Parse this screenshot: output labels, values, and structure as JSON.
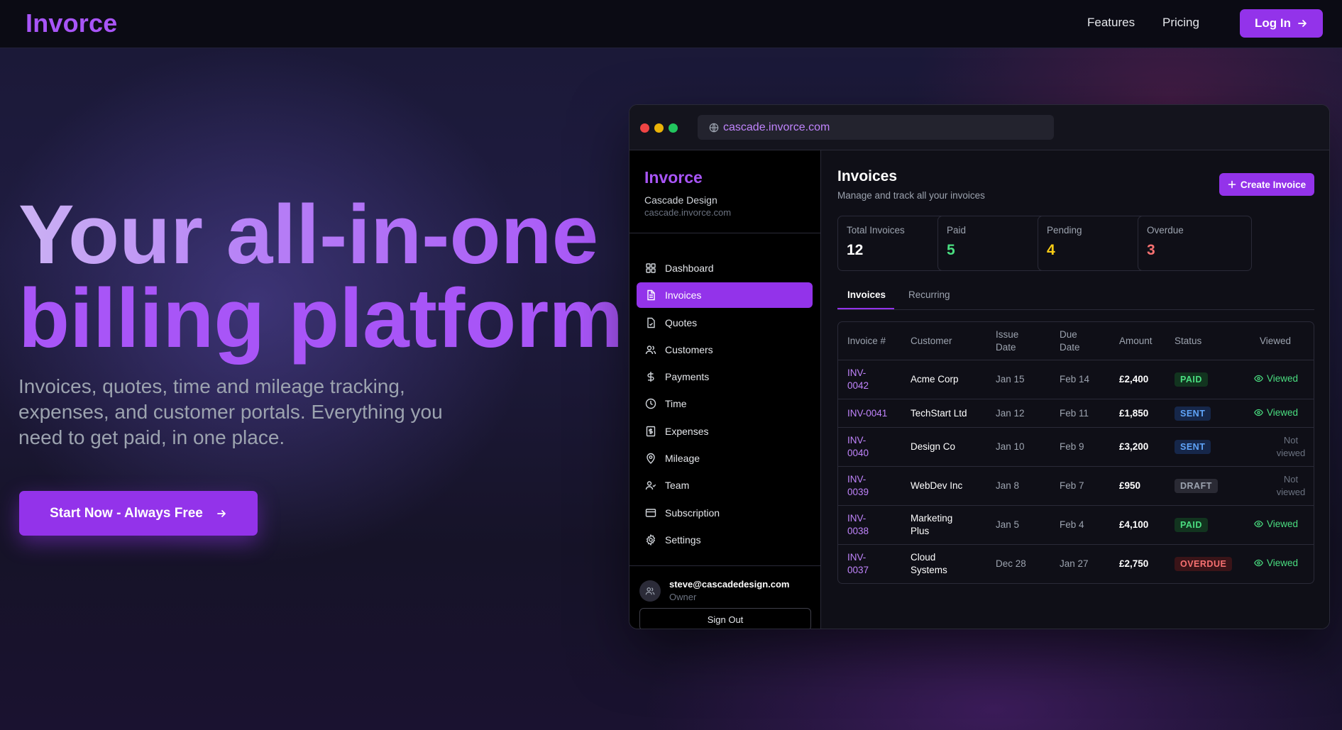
{
  "nav": {
    "brand": "Invorce",
    "features": "Features",
    "pricing": "Pricing",
    "login": "Log In"
  },
  "hero": {
    "title_line1": "Your all-in-one",
    "title_line2": "billing platform",
    "subtitle": "Invoices, quotes, time and mileage tracking, expenses, and customer portals. Everything you need to get paid, in one place.",
    "cta": "Start Now - Always Free"
  },
  "browser": {
    "url": "cascade.invorce.com"
  },
  "app": {
    "brand": "Invorce",
    "company": "Cascade Design",
    "domain": "cascade.invorce.com",
    "menu": [
      {
        "label": "Dashboard",
        "icon": "dashboard-icon"
      },
      {
        "label": "Invoices",
        "icon": "invoice-icon"
      },
      {
        "label": "Quotes",
        "icon": "quote-icon"
      },
      {
        "label": "Customers",
        "icon": "customers-icon"
      },
      {
        "label": "Payments",
        "icon": "dollar-icon"
      },
      {
        "label": "Time",
        "icon": "clock-icon"
      },
      {
        "label": "Expenses",
        "icon": "receipt-icon"
      },
      {
        "label": "Mileage",
        "icon": "map-pin-icon"
      },
      {
        "label": "Team",
        "icon": "team-icon"
      },
      {
        "label": "Subscription",
        "icon": "credit-card-icon"
      },
      {
        "label": "Settings",
        "icon": "gear-icon"
      }
    ],
    "active_menu": "Invoices",
    "user": {
      "email": "steve@cascadedesign.com",
      "role": "Owner",
      "signout": "Sign Out"
    },
    "page": {
      "title": "Invoices",
      "subtitle": "Manage and track all your invoices",
      "create_label": "Create Invoice"
    },
    "stats": [
      {
        "label": "Total Invoices",
        "value": "12",
        "color": "#ffffff"
      },
      {
        "label": "Paid",
        "value": "5",
        "color": "#4ade80"
      },
      {
        "label": "Pending",
        "value": "4",
        "color": "#facc15"
      },
      {
        "label": "Overdue",
        "value": "3",
        "color": "#f87171"
      }
    ],
    "tabs": [
      "Invoices",
      "Recurring"
    ],
    "table": {
      "headers": {
        "invoice": "Invoice #",
        "customer": "Customer",
        "issue_line1": "Issue",
        "issue_line2": "Date",
        "due_line1": "Due",
        "due_line2": "Date",
        "amount": "Amount",
        "status": "Status",
        "viewed": "Viewed"
      },
      "rows": [
        {
          "id1": "INV-",
          "id2": "0042",
          "customer1": "Acme Corp",
          "customer2": "",
          "issue": "Jan 15",
          "due": "Feb 14",
          "amount": "£2,400",
          "status": "PAID",
          "viewed": "Viewed"
        },
        {
          "id1": "INV-0041",
          "id2": "",
          "customer1": "TechStart Ltd",
          "customer2": "",
          "issue": "Jan 12",
          "due": "Feb 11",
          "amount": "£1,850",
          "status": "SENT",
          "viewed": "Viewed"
        },
        {
          "id1": "INV-",
          "id2": "0040",
          "customer1": "Design Co",
          "customer2": "",
          "issue": "Jan 10",
          "due": "Feb 9",
          "amount": "£3,200",
          "status": "SENT",
          "viewed": "Not viewed"
        },
        {
          "id1": "INV-",
          "id2": "0039",
          "customer1": "WebDev Inc",
          "customer2": "",
          "issue": "Jan 8",
          "due": "Feb 7",
          "amount": "£950",
          "status": "DRAFT",
          "viewed": "Not viewed"
        },
        {
          "id1": "INV-",
          "id2": "0038",
          "customer1": "Marketing",
          "customer2": "Plus",
          "issue": "Jan 5",
          "due": "Feb 4",
          "amount": "£4,100",
          "status": "PAID",
          "viewed": "Viewed"
        },
        {
          "id1": "INV-",
          "id2": "0037",
          "customer1": "Cloud",
          "customer2": "Systems",
          "issue": "Dec 28",
          "due": "Jan 27",
          "amount": "£2,750",
          "status": "OVERDUE",
          "viewed": "Viewed"
        }
      ]
    }
  },
  "colors": {
    "accent": "#9333ea",
    "brand": "#a855f7",
    "paid": "#4ade80",
    "sent": "#60a5fa",
    "overdue": "#f87171"
  }
}
